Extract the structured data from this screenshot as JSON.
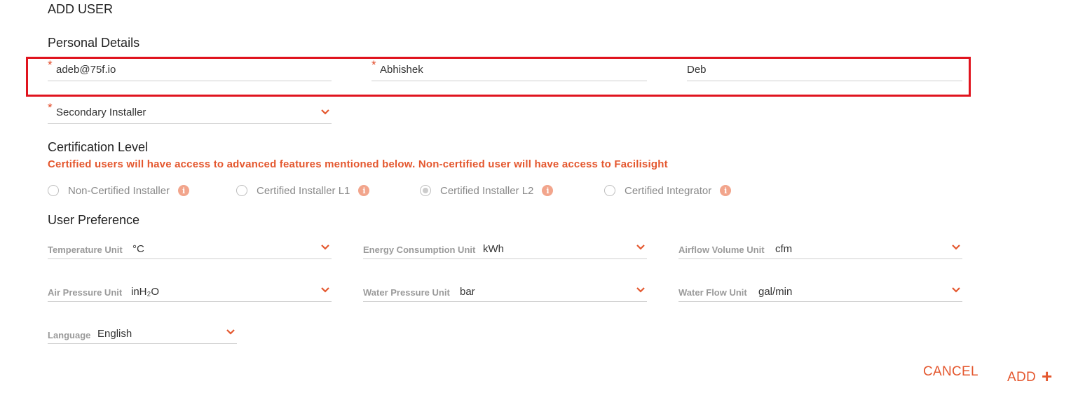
{
  "page_title": "ADD USER",
  "personal": {
    "heading": "Personal Details",
    "email": "adeb@75f.io",
    "first_name": "Abhishek",
    "last_name": "Deb",
    "role": "Secondary Installer",
    "required_mark": "*"
  },
  "certification": {
    "heading": "Certification Level",
    "note": "Certified users will have access to advanced features mentioned below. Non-certified user will have access to Facilisight",
    "options": [
      {
        "label": "Non-Certified Installer",
        "selected": false
      },
      {
        "label": "Certified Installer L1",
        "selected": false
      },
      {
        "label": "Certified Installer L2",
        "selected": true
      },
      {
        "label": "Certified Integrator",
        "selected": false
      }
    ],
    "info_glyph": "i"
  },
  "preference": {
    "heading": "User Preference",
    "temperature": {
      "label": "Temperature Unit",
      "value": "°C"
    },
    "energy": {
      "label": "Energy Consumption Unit",
      "value": "kWh"
    },
    "airflow": {
      "label": "Airflow Volume Unit",
      "value": "cfm"
    },
    "air_pressure": {
      "label": "Air Pressure Unit",
      "value": "inH₂O"
    },
    "water_pressure": {
      "label": "Water Pressure Unit",
      "value": "bar"
    },
    "water_flow": {
      "label": "Water Flow Unit",
      "value": "gal/min"
    },
    "language": {
      "label": "Language",
      "value": "English"
    }
  },
  "actions": {
    "cancel": "CANCEL",
    "add": "ADD",
    "add_icon": "+"
  },
  "colors": {
    "accent": "#e4572e",
    "highlight": "#e0141e"
  }
}
